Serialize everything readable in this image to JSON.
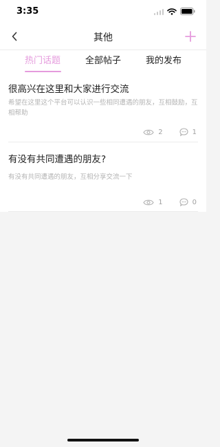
{
  "status_bar": {
    "time": "3:35"
  },
  "nav": {
    "title": "其他"
  },
  "tabs": [
    {
      "label": "热门话题",
      "active": true
    },
    {
      "label": "全部帖子",
      "active": false
    },
    {
      "label": "我的发布",
      "active": false
    }
  ],
  "posts": [
    {
      "title": "很高兴在这里和大家进行交流",
      "body": "希望在这里这个平台可以认识一些相同遭遇的朋友，互相鼓励，互相帮助",
      "views": "2",
      "comments": "1"
    },
    {
      "title": "有没有共同遭遇的朋友?",
      "body": "有没有共同遭遇的朋友，互相分享交流一下",
      "views": "1",
      "comments": "0"
    }
  ],
  "colors": {
    "accent": "#e59bdd",
    "background": "#f4f4f4",
    "muted": "#b4b4b4"
  },
  "icons": [
    "back-chevron-icon",
    "add-icon",
    "eye-icon",
    "comment-icon",
    "signal-icon",
    "wifi-icon",
    "battery-icon"
  ]
}
